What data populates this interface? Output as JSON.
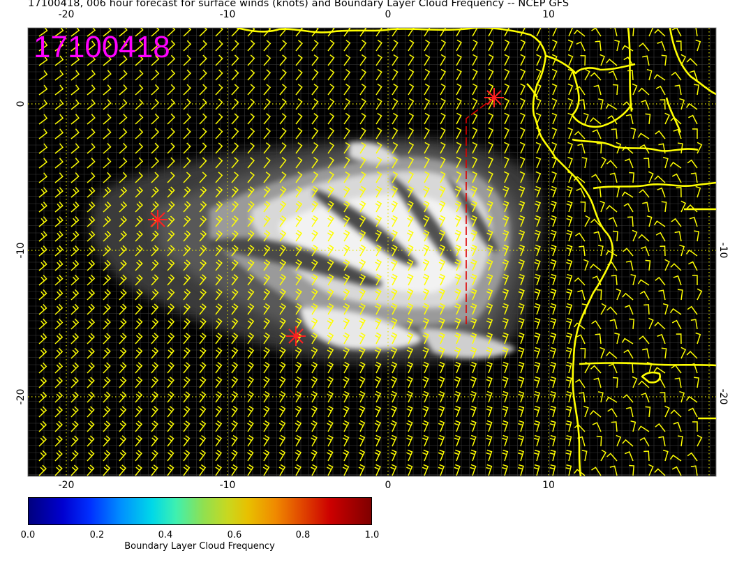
{
  "title": "17100418, 006 hour forecast for surface winds (knots) and Boundary Layer Cloud Frequency -- NCEP GFS",
  "map": {
    "stamp": "17100418",
    "lon_ticks": [
      "-20",
      "-10",
      "0",
      "10"
    ],
    "lat_ticks": [
      "0",
      "-10",
      "-20"
    ],
    "overlay_colors": {
      "barbs": "#ffff00",
      "coastline": "#ffff00",
      "stamp": "#ff00ff",
      "markers": "#ff2020",
      "track": "#dd0000"
    },
    "marker_icons": [
      "star-marker-icon",
      "star-marker-icon",
      "star-marker-icon"
    ]
  },
  "colorbar": {
    "label": "Boundary Layer Cloud Frequency",
    "ticks": [
      "0.0",
      "0.2",
      "0.4",
      "0.6",
      "0.8",
      "1.0"
    ],
    "range": [
      0.0,
      1.0
    ]
  }
}
